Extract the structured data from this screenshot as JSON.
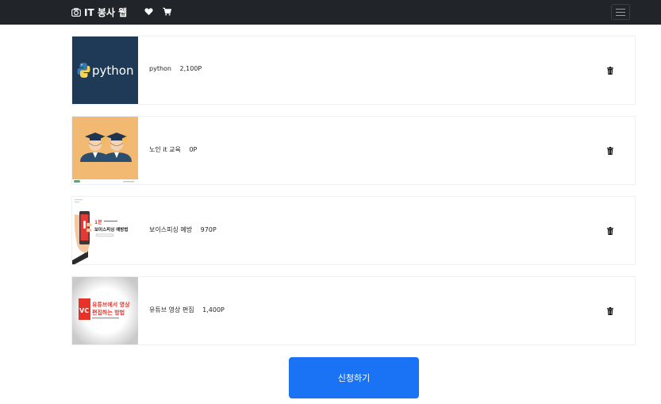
{
  "navbar": {
    "brand_label": "IT 봉사 웹",
    "icons": [
      "camera-icon",
      "heart-icon",
      "cart-icon",
      "menu-icon"
    ],
    "background": "#212529"
  },
  "items": [
    {
      "thumbnail_text": "python",
      "name": "python",
      "price": "2,100P"
    },
    {
      "name": "노인 it 교육",
      "price": "0P"
    },
    {
      "thumbnail_text": [
        "보이스피싱 예방법"
      ],
      "name": "보이스피싱 예방",
      "price": "970P"
    },
    {
      "thumbnail_text": [
        "유튜브에서 영상",
        "편집하는 방법"
      ],
      "name": "유튜브 영상 편집",
      "price": "1,400P"
    }
  ],
  "submit_label": "신청하기",
  "colors": {
    "accent": "#1a73f5",
    "python_bg": "#1f3a56",
    "edu_bg": "#f1b971"
  }
}
